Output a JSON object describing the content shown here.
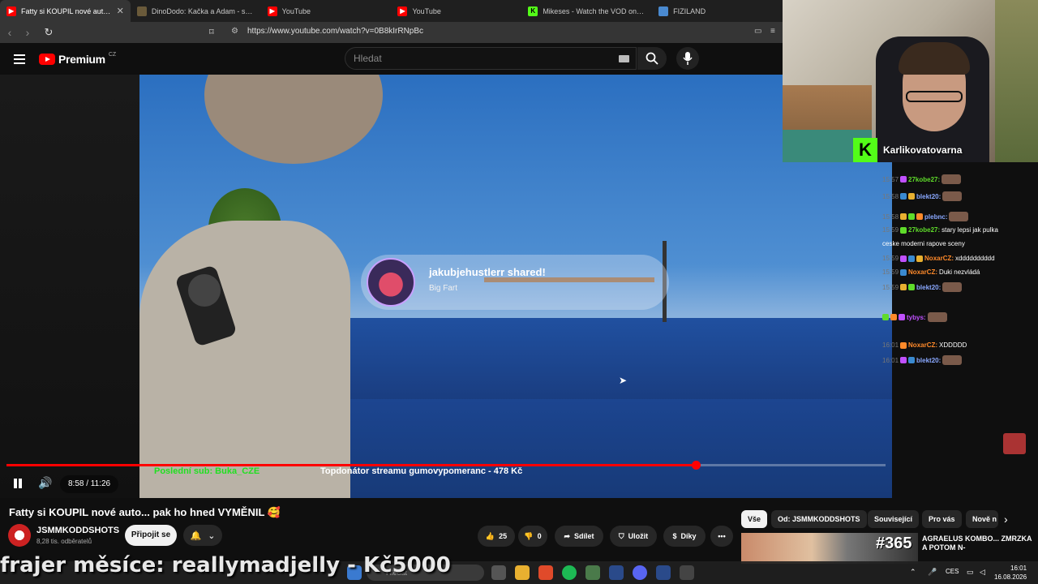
{
  "browser": {
    "tabs": [
      {
        "label": "Fatty si KOUPIL nové auto... pak ho hned VYMĚNIL",
        "icon": "youtube-icon",
        "active": true
      },
      {
        "label": "DinoDodo: Kačka a Adam - sourozenci",
        "icon": "page-icon",
        "active": false
      },
      {
        "label": "YouTube",
        "icon": "youtube-icon",
        "active": false
      },
      {
        "label": "YouTube",
        "icon": "youtube-icon",
        "active": false
      },
      {
        "label": "Mikeses - Watch the VOD on Kick",
        "icon": "kick-icon",
        "active": false
      },
      {
        "label": "FIZILAND",
        "icon": "page-icon",
        "active": false
      }
    ],
    "url": "https://www.youtube.com/watch?v=0B8kIrRNpBc"
  },
  "youtube": {
    "logo_text": "Premium",
    "logo_region": "CZ",
    "search_placeholder": "Hledat"
  },
  "player": {
    "current_time": "8:58",
    "duration": "11:26",
    "time_display": "8:58 / 11:26",
    "progress_fraction": 0.784,
    "overlay_last_sub": "Poslední sub: Buka_CZE",
    "overlay_top_donator": "Topdonátor streamu gumovypomeranc - 478 Kč"
  },
  "alert": {
    "title": "jakubjehustlerr shared!",
    "subtitle": "Big Fart"
  },
  "webcam": {
    "channel_name": "Karlikovatovarna",
    "kick_letter": "K"
  },
  "chat": [
    {
      "time": "15:57",
      "user": "27kobe27:",
      "user_class": "u1",
      "message": ""
    },
    {
      "time": "15:58",
      "user": "blekt20:",
      "user_class": "u2",
      "message": ""
    },
    {
      "time": "15:58",
      "user": "plebnc:",
      "user_class": "u2",
      "message": ""
    },
    {
      "time": "15:59",
      "user": "27kobe27:",
      "user_class": "u1",
      "message": "stary lepsi jak pulka"
    },
    {
      "time": "",
      "user": "",
      "user_class": "msg",
      "message": "ceske moderni rapove sceny"
    },
    {
      "time": "15:59",
      "user": "NoxarCZ:",
      "user_class": "u3",
      "message": "xdddddddddd"
    },
    {
      "time": "15:59",
      "user": "NoxarCZ:",
      "user_class": "u3",
      "message": "Duki nezvládá"
    },
    {
      "time": "15:59",
      "user": "blekt20:",
      "user_class": "u2",
      "message": ""
    },
    {
      "time": "",
      "user": "tybys:",
      "user_class": "u4",
      "message": ""
    },
    {
      "time": "16:01",
      "user": "NoxarCZ:",
      "user_class": "u3",
      "message": "XDDDDD"
    },
    {
      "time": "16:01",
      "user": "blekt20:",
      "user_class": "u2",
      "message": ""
    }
  ],
  "video": {
    "title": "Fatty si KOUPIL nové auto... pak ho hned VYMĚNIL 🥰",
    "channel": "JSMMKODDSHOTS",
    "subscribers": "8,28 tis. odběratelů",
    "join_label": "Připojit se",
    "likes": "25",
    "dislikes": "0",
    "share_label": "Sdílet",
    "save_label": "Uložit",
    "thanks_label": "Díky",
    "more_label": "•••"
  },
  "chips": [
    "Vše",
    "Od: JSMMKODDSHOTS",
    "Související",
    "Pro vás",
    "Nově n"
  ],
  "related": {
    "badge_number": "#365",
    "title": "AGRAELUS KOMBO... ZMRZKA A POTOM N-"
  },
  "banner": {
    "text": "frajer měsíce: reallymadjelly - Kč5000"
  },
  "taskbar": {
    "search_placeholder": "Hledat",
    "lang": "CES",
    "time": "16:01",
    "date": "16.08.2026"
  }
}
